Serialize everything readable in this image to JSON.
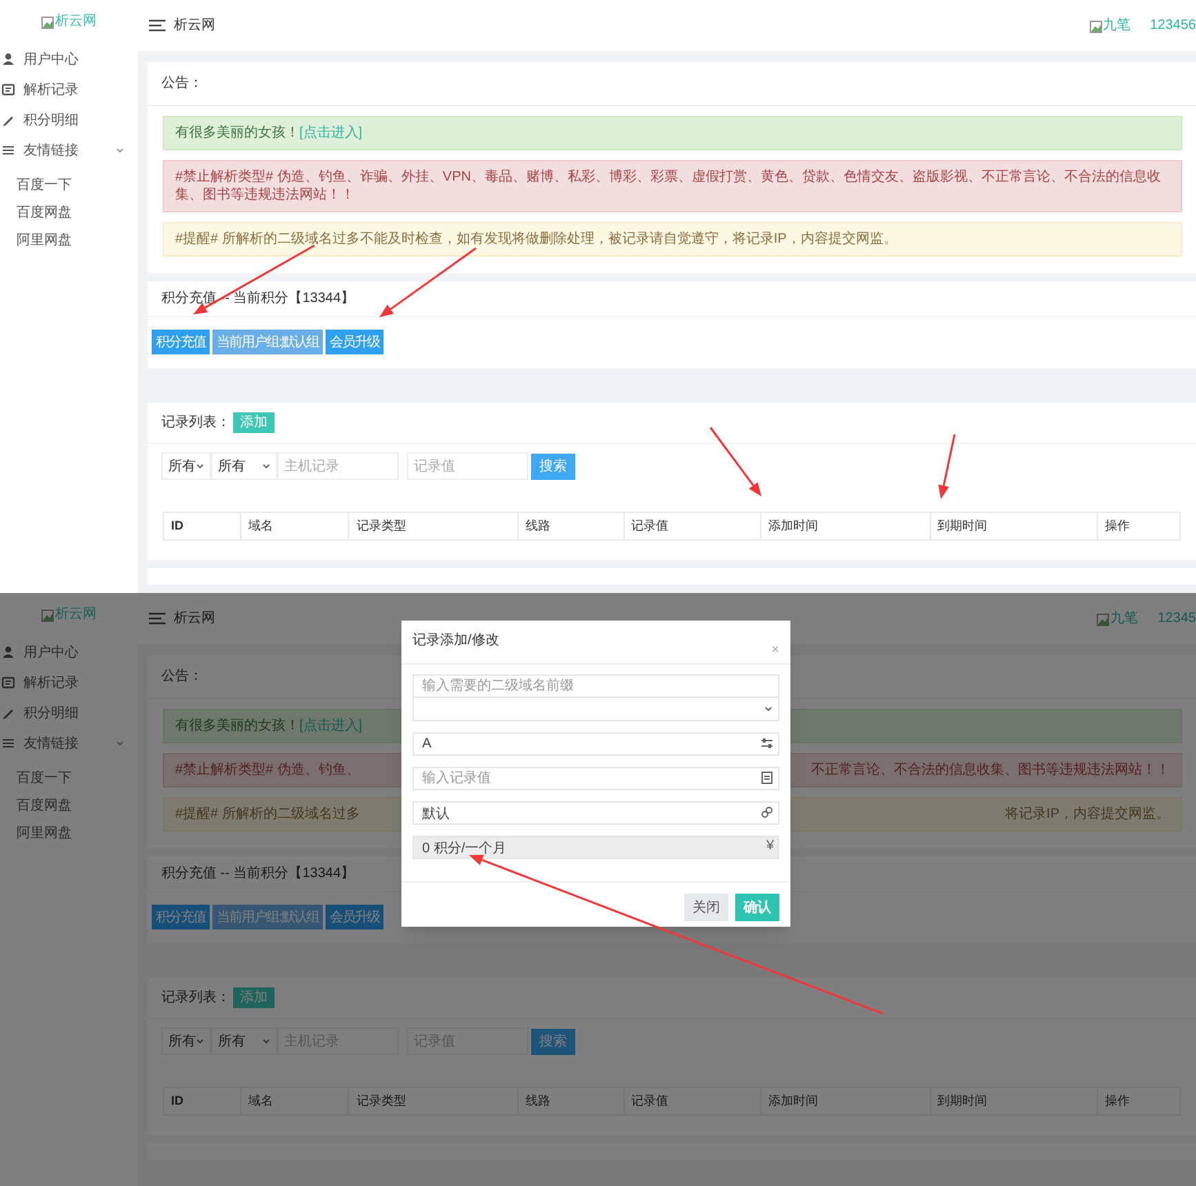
{
  "screens": [
    {
      "dimmed": false,
      "sidebar": {
        "logo": "析云网",
        "items": [
          {
            "label": "用户中心"
          },
          {
            "label": "解析记录"
          },
          {
            "label": "积分明细"
          },
          {
            "label": "友情链接",
            "expanded": true,
            "children": [
              {
                "label": "百度一下"
              },
              {
                "label": "百度网盘"
              },
              {
                "label": "阿里网盘"
              }
            ]
          }
        ]
      },
      "header": {
        "title": "析云网",
        "user": "九笔",
        "account": "123456"
      },
      "notice": {
        "title": "公告：",
        "alerts": [
          {
            "kind": "success",
            "segments": [
              "有很多美丽的女孩！"
            ],
            "link": "[点击进入]"
          },
          {
            "kind": "danger",
            "segments": [
              "#禁止解析类型# 伪造、钓鱼、诈骗、外挂、VPN、毒品、赌博、私彩、博彩、彩票、虚假打赏、黄色、贷款、色情交友、盗版影视、不正常言论、不合法的信息收集、图书等违规违法网站！！"
            ]
          },
          {
            "kind": "warning",
            "segments": [
              "#提醒# 所解析的二级域名过多不能及时检查，如有发现将做删除处理，被记录请自觉遵守，将记录IP，内容提交网监。"
            ]
          }
        ]
      },
      "points": {
        "title": "积分充值 -- 当前积分【13344】",
        "buttons": [
          {
            "label": "积分充值",
            "disabled": false
          },
          {
            "label": "当前用户组:默认组",
            "disabled": true
          },
          {
            "label": "会员升级",
            "disabled": false
          }
        ]
      },
      "records": {
        "title": "记录列表：",
        "add": "添加",
        "filters": [
          {
            "kind": "select",
            "value": "所有"
          },
          {
            "kind": "select",
            "value": "所有"
          },
          {
            "kind": "input",
            "placeholder": "主机记录"
          },
          {
            "kind": "input",
            "placeholder": "记录值"
          }
        ],
        "search": "搜索",
        "columns": [
          "ID",
          "域名",
          "记录类型",
          "线路",
          "记录值",
          "添加时间",
          "到期时间",
          "操作"
        ]
      }
    },
    {
      "dimmed": true,
      "sidebar": {
        "logo": "析云网",
        "items": [
          {
            "label": "用户中心"
          },
          {
            "label": "解析记录"
          },
          {
            "label": "积分明细"
          },
          {
            "label": "友情链接",
            "expanded": true,
            "children": [
              {
                "label": "百度一下"
              },
              {
                "label": "百度网盘"
              },
              {
                "label": "阿里网盘"
              }
            ]
          }
        ]
      },
      "header": {
        "title": "析云网",
        "user": "九笔",
        "account": "12345"
      },
      "notice": {
        "title": "公告：",
        "alerts": [
          {
            "kind": "success",
            "segments": [
              "有很多美丽的女孩！"
            ],
            "link": "[点击进入]"
          },
          {
            "kind": "danger",
            "segments": [
              "#禁止解析类型# 伪造、钓鱼、",
              "不正常言论、不合法的信息收集、图书等违规违法网站！！"
            ]
          },
          {
            "kind": "warning",
            "segments": [
              "#提醒# 所解析的二级域名过多",
              "将记录IP，内容提交网监。"
            ]
          }
        ]
      },
      "points": {
        "title": "积分充值 -- 当前积分【13344】",
        "buttons": [
          {
            "label": "积分充值",
            "disabled": false
          },
          {
            "label": "当前用户组:默认组",
            "disabled": true
          },
          {
            "label": "会员升级",
            "disabled": false
          }
        ]
      },
      "records": {
        "title": "记录列表：",
        "add": "添加",
        "filters": [
          {
            "kind": "select",
            "value": "所有"
          },
          {
            "kind": "select",
            "value": "所有"
          },
          {
            "kind": "input",
            "placeholder": "主机记录"
          },
          {
            "kind": "input",
            "placeholder": "记录值"
          }
        ],
        "search": "搜索",
        "columns": [
          "ID",
          "域名",
          "记录类型",
          "线路",
          "记录值",
          "添加时间",
          "到期时间",
          "操作"
        ]
      },
      "modal": {
        "title": "记录添加/修改",
        "close": "×",
        "fields": [
          {
            "kind": "input",
            "placeholder": "输入需要的二级域名前缀"
          },
          {
            "kind": "select"
          },
          {
            "kind": "input",
            "value": "A",
            "disabled": false
          },
          {
            "kind": "input",
            "placeholder": "输入记录值"
          },
          {
            "kind": "input",
            "value": "默认",
            "disabled": false
          },
          {
            "kind": "input",
            "value": "0 积分/一个月",
            "disabled": true,
            "suffix": "¥"
          }
        ],
        "buttons": [
          {
            "label": "关闭",
            "kind": "secondary"
          },
          {
            "label": "确认",
            "kind": "primary"
          }
        ]
      }
    }
  ]
}
